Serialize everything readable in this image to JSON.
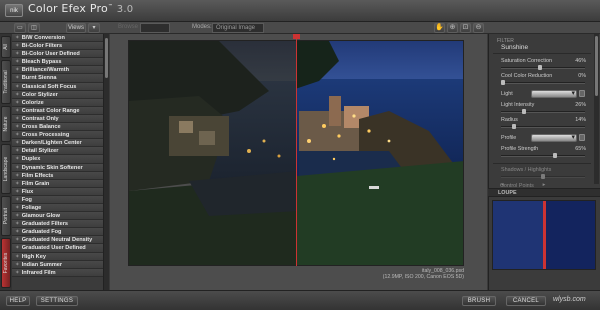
{
  "app": {
    "logo_text": "nik",
    "title": "Color Efex Pro",
    "version": "3.0"
  },
  "toolbar": {
    "views_label": "Views",
    "zoom_label": "Browse",
    "modes_label": "Modes:",
    "modes_value": "Original Image"
  },
  "side_tabs": [
    "All",
    "Traditional",
    "Nature",
    "Landscape",
    "Portrait",
    "Favorites"
  ],
  "filters": [
    "B/W Conversion",
    "Bi-Color Filters",
    "Bi-Color User Defined",
    "Bleach Bypass",
    "Brilliance/Warmth",
    "Burnt Sienna",
    "Classical Soft Focus",
    "Color Stylizer",
    "Colorize",
    "Contrast Color Range",
    "Contrast Only",
    "Cross Balance",
    "Cross Processing",
    "Darken/Lighten Center",
    "Detail Stylizer",
    "Duplex",
    "Dynamic Skin Softener",
    "Film Effects",
    "Film Grain",
    "Flux",
    "Fog",
    "Foliage",
    "Glamour Glow",
    "Graduated Filters",
    "Graduated Fog",
    "Graduated Neutral Density",
    "Graduated User Defined",
    "High Key",
    "Indian Summer",
    "Infrared Film"
  ],
  "image_meta": {
    "filename": "italy_008_036.psd",
    "details": "(12.9MP, ISO 200, Canon EOS 5D)"
  },
  "panel": {
    "section_label": "FILTER",
    "filter_name": "Sunshine",
    "controls": [
      {
        "label": "Saturation Correction",
        "value": "46%",
        "level": 0.46
      },
      {
        "label": "Cool Color Reduction",
        "value": "0%",
        "level": 0.0
      },
      {
        "label": "Light",
        "value": "",
        "type": "dropdown"
      },
      {
        "label": "Light Intensity",
        "value": "26%",
        "level": 0.26
      },
      {
        "label": "Radius",
        "value": "14%",
        "level": 0.14
      },
      {
        "label": "Profile",
        "value": "",
        "type": "dropdown"
      },
      {
        "label": "Profile Strength",
        "value": "65%",
        "level": 0.65
      }
    ],
    "collapsed_1": "Shadows / Highlights",
    "collapsed_2": "Control Points",
    "loupe_label": "LOUPE"
  },
  "bottom": {
    "help": "HELP",
    "settings": "SETTINGS",
    "brush": "BRUSH",
    "cancel": "CANCEL",
    "watermark": "wlysb.com"
  }
}
